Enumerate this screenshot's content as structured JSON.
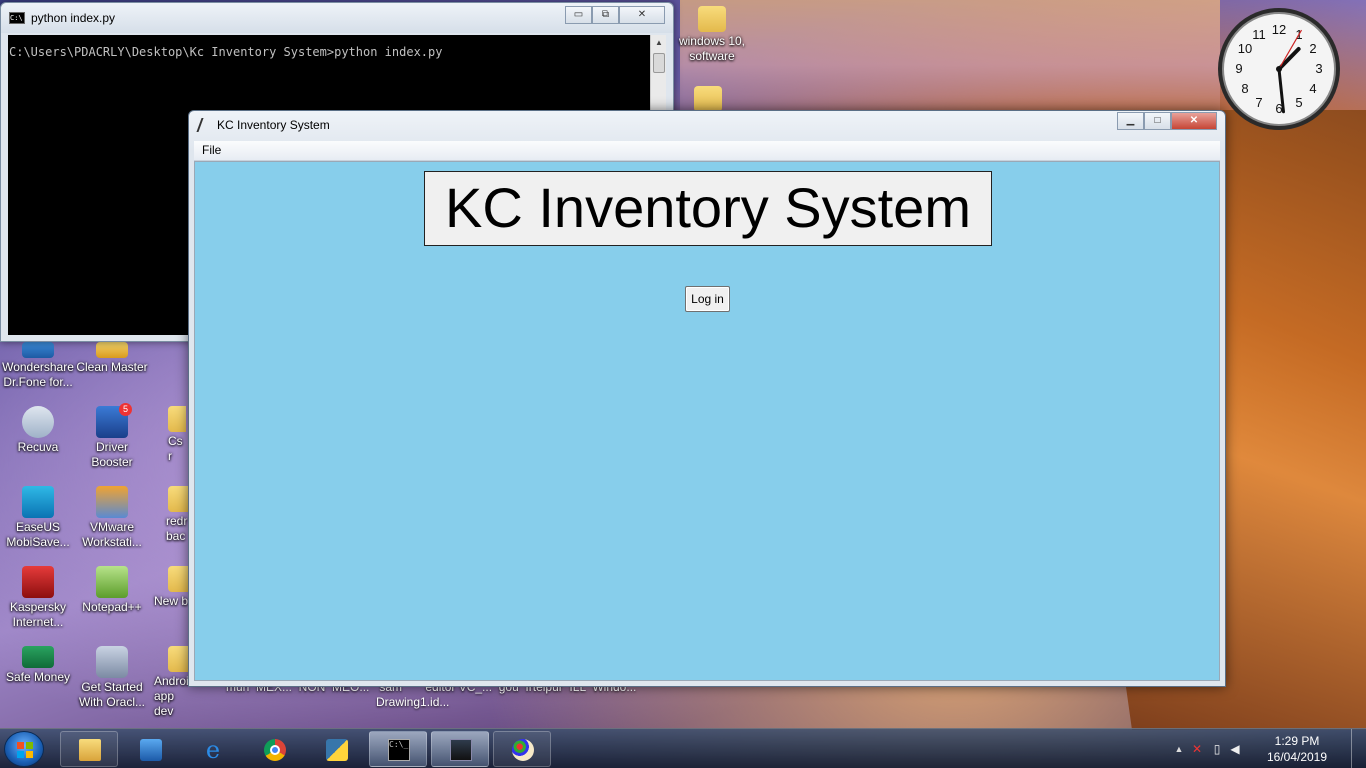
{
  "console_window": {
    "title": "python  index.py",
    "prompt_line": "C:\\Users\\PDACRLY\\Desktop\\Kc Inventory System>python index.py",
    "minimize_glyph": "▭",
    "maximize_glyph": "⧉",
    "close_glyph": "✕"
  },
  "app_window": {
    "title": "KC Inventory System",
    "menu": [
      "File"
    ],
    "heading": "KC Inventory System",
    "login_label": "Log in",
    "background_color": "#87ceeb",
    "minimize_glyph": "▁",
    "maximize_glyph": "□",
    "close_glyph": "✕"
  },
  "desktop_icons": [
    {
      "label": "windows 10, software",
      "icon": "folder-icon"
    },
    {
      "label": "Wondershare Dr.Fone for...",
      "icon": "drfone-icon"
    },
    {
      "label": "Clean Master",
      "icon": "clean-master-icon"
    },
    {
      "label": "Recuva",
      "icon": "recuva-icon"
    },
    {
      "label": "Driver Booster",
      "icon": "driver-booster-icon",
      "badge": "5"
    },
    {
      "label": "EaseUS MobiSave...",
      "icon": "easeus-icon"
    },
    {
      "label": "VMware Workstati...",
      "icon": "vmware-icon"
    },
    {
      "label": "Kaspersky Internet...",
      "icon": "kaspersky-icon"
    },
    {
      "label": "Notepad++",
      "icon": "notepad-plus-icon"
    },
    {
      "label": "Safe Money",
      "icon": "safe-money-icon"
    },
    {
      "label": "Get Started With Oracl...",
      "icon": "oracle-xe-icon"
    }
  ],
  "partial_labels": {
    "cs": "Cs r",
    "redr": "redr bac",
    "newb": "New b",
    "android": "Android app dev",
    "drawing": "Drawing1.id...",
    "row_bottom": "mun  MEX...  NON  MEO...   sam       editor VC_...  gou  Irtelpur  ILL  Windo..."
  },
  "taskbar": {
    "items": [
      {
        "name": "explorer",
        "icon": "folder-icon"
      },
      {
        "name": "media-player",
        "icon": "media-player-icon"
      },
      {
        "name": "internet-explorer",
        "icon": "ie-icon"
      },
      {
        "name": "chrome",
        "icon": "chrome-icon"
      },
      {
        "name": "python-file",
        "icon": "python-file-icon"
      },
      {
        "name": "cmd",
        "icon": "cmd-icon"
      },
      {
        "name": "python-idle",
        "icon": "python-idle-icon"
      },
      {
        "name": "paint",
        "icon": "paint-icon"
      }
    ],
    "time": "1:29 PM",
    "date": "16/04/2019"
  },
  "clock": {
    "hour": 1,
    "minute": 29,
    "second": 5
  }
}
